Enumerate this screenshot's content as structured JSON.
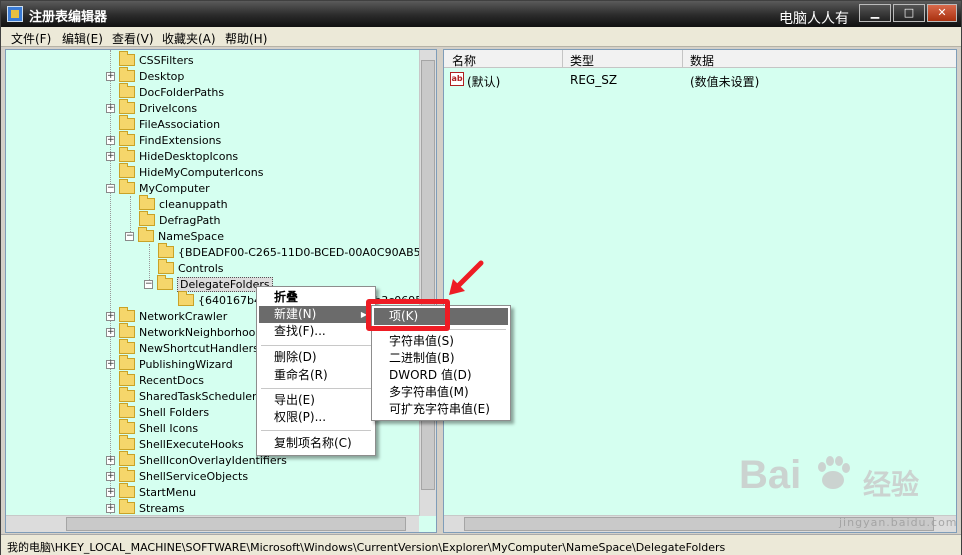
{
  "window": {
    "title": "注册表编辑器",
    "watermark_caption": "电脑人人有"
  },
  "menubar": [
    "文件(F)",
    "编辑(E)",
    "查看(V)",
    "收藏夹(A)",
    "帮助(H)"
  ],
  "tree": {
    "items": [
      {
        "label": "CSSFilters"
      },
      {
        "label": "Desktop"
      },
      {
        "label": "DocFolderPaths"
      },
      {
        "label": "DriveIcons"
      },
      {
        "label": "FileAssociation"
      },
      {
        "label": "FindExtensions"
      },
      {
        "label": "HideDesktopIcons"
      },
      {
        "label": "HideMyComputerIcons"
      },
      {
        "label": "MyComputer"
      },
      {
        "label": "cleanuppath"
      },
      {
        "label": "DefragPath"
      },
      {
        "label": "NameSpace"
      },
      {
        "label": "{BDEADF00-C265-11D0-BCED-00A0C90AB50F}"
      },
      {
        "label": "Controls"
      },
      {
        "label": "DelegateFolders"
      },
      {
        "label": "{640167b4-59b0-47a6-b335-a6b3c0695aea}"
      },
      {
        "label": "NetworkCrawler"
      },
      {
        "label": "NetworkNeighborhood"
      },
      {
        "label": "NewShortcutHandlers"
      },
      {
        "label": "PublishingWizard"
      },
      {
        "label": "RecentDocs"
      },
      {
        "label": "SharedTaskScheduler"
      },
      {
        "label": "Shell Folders"
      },
      {
        "label": "Shell Icons"
      },
      {
        "label": "ShellExecuteHooks"
      },
      {
        "label": "ShellIconOverlayIdentifiers"
      },
      {
        "label": "ShellServiceObjects"
      },
      {
        "label": "StartMenu"
      },
      {
        "label": "Streams"
      }
    ]
  },
  "list": {
    "columns": [
      "名称",
      "类型",
      "数据"
    ],
    "rows": [
      {
        "name": "(默认)",
        "type": "REG_SZ",
        "data": "(数值未设置)",
        "icon": "ab-string-icon"
      }
    ]
  },
  "context_menu": {
    "items": [
      "折叠",
      "新建(N)",
      "查找(F)...",
      "删除(D)",
      "重命名(R)",
      "导出(E)",
      "权限(P)...",
      "复制项名称(C)"
    ],
    "highlighted": "新建(N)"
  },
  "submenu": {
    "items": [
      "项(K)",
      "字符串值(S)",
      "二进制值(B)",
      "DWORD 值(D)",
      "多字符串值(M)",
      "可扩充字符串值(E)"
    ],
    "highlighted": "项(K)"
  },
  "watermark": {
    "logo_text_1": "Bai",
    "logo_text_2": "经验",
    "url": "jingyan.baidu.com"
  },
  "statusbar": {
    "path": "我的电脑\\HKEY_LOCAL_MACHINE\\SOFTWARE\\Microsoft\\Windows\\CurrentVersion\\Explorer\\MyComputer\\NameSpace\\DelegateFolders"
  },
  "colors": {
    "pane_bg": "#d5fff0",
    "highlight": "#6b6b6b",
    "annotation_red": "#ee1c24"
  }
}
